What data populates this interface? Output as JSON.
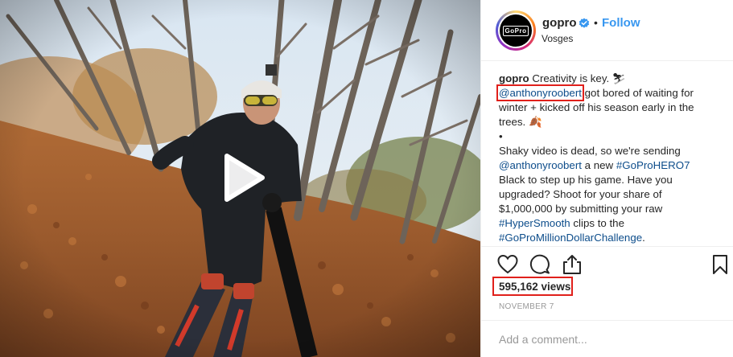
{
  "post": {
    "username": "gopro",
    "follow_label": "Follow",
    "location": "Vosges",
    "avatar_text": "GoPro",
    "separator": "•"
  },
  "caption": {
    "author": "gopro",
    "line1_text": "Creativity is key.",
    "line1_emoji": "⛷",
    "mention1": "@anthonyroobert",
    "line2_rest": "got bored of waiting for",
    "line3": "winter + kicked off his season early in the",
    "line4_text": "trees.",
    "line4_emoji": "🍂",
    "line5": "•",
    "line6": "Shaky video is dead, so we're sending",
    "mention2": "@anthonyroobert",
    "line7_mid": "a new",
    "hashtag1": "#GoProHERO7",
    "line8": "Black to step up his game. Have you",
    "line9": "upgraded? Shoot for your share of",
    "line10": "$1,000,000 by submitting your raw",
    "hashtag2": "#HyperSmooth",
    "line11_rest": "clips to the",
    "hashtag3": "#GoProMillionDollarChallenge",
    "line12_end": "."
  },
  "stats": {
    "views": "595,162 views",
    "date": "NOVEMBER 7"
  },
  "comment": {
    "placeholder": "Add a comment..."
  },
  "icons": {
    "like": "heart-icon",
    "comment": "comment-icon",
    "share": "share-icon",
    "save": "bookmark-icon",
    "verified": "verified-badge-icon",
    "play": "play-icon"
  },
  "colors": {
    "link": "#3897f0",
    "hashtag": "#0d4d8b",
    "highlight": "#e0201b",
    "text": "#262626",
    "muted": "#999999"
  }
}
